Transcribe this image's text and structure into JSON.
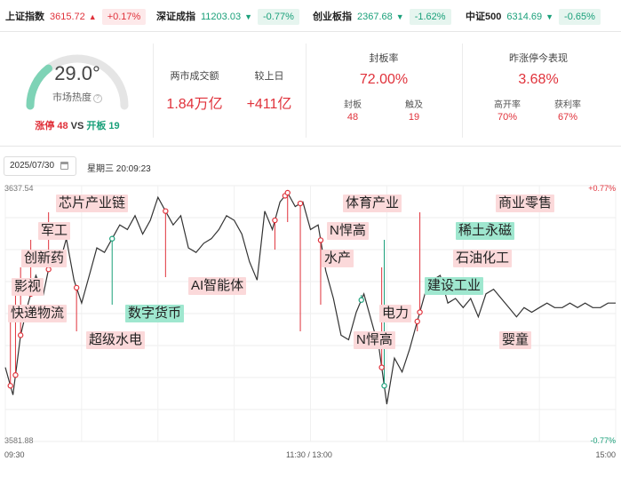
{
  "indices": [
    {
      "name": "上证指数",
      "value": "3615.72",
      "arrow": "▲",
      "change": "+0.17%",
      "dir": "up"
    },
    {
      "name": "深证成指",
      "value": "11203.03",
      "arrow": "▼",
      "change": "-0.77%",
      "dir": "down"
    },
    {
      "name": "创业板指",
      "value": "2367.68",
      "arrow": "▼",
      "change": "-1.62%",
      "dir": "down"
    },
    {
      "name": "中证500",
      "value": "6314.69",
      "arrow": "▼",
      "change": "-0.65%",
      "dir": "down"
    }
  ],
  "heat": {
    "value": "29.0°",
    "label": "市场热度",
    "help_icon": "question-icon",
    "limit_up_label": "涨停 48",
    "vs": "VS",
    "open_board_label": "开板 19",
    "level": 0.29
  },
  "turnover": {
    "label": "两市成交额",
    "value": "1.84万亿"
  },
  "vs_yesterday": {
    "label": "较上日",
    "value": "+411亿"
  },
  "seal_rate": {
    "label": "封板率",
    "value": "72.00%",
    "sub": [
      {
        "label": "封板",
        "value": "48"
      },
      {
        "label": "触及",
        "value": "19"
      }
    ]
  },
  "yesterday_perf": {
    "label": "昨涨停今表现",
    "value": "3.68%",
    "sub": [
      {
        "label": "高开率",
        "value": "70%"
      },
      {
        "label": "获利率",
        "value": "67%"
      }
    ]
  },
  "date": "2025/07/30",
  "weekday_time": "星期三 20:09:23",
  "colors": {
    "up": "#e0323b",
    "down": "#1aa07a",
    "line": "#333333",
    "tag_red": "#fbd9da",
    "tag_green": "#9fe7cf",
    "gauge": "#7ed3b6"
  },
  "chart_data": {
    "type": "line",
    "y_axis_labels": {
      "top": "3637.54",
      "bottom": "3581.88"
    },
    "right_axis_labels": {
      "top": "+0.77%",
      "bottom": "-0.77%"
    },
    "x_labels": [
      "09:30",
      "11:30 / 13:00",
      "15:00"
    ],
    "ylim": [
      3581.88,
      3637.54
    ],
    "grid": true,
    "series": [
      {
        "x": [
          0,
          3,
          6,
          9,
          12,
          15,
          18,
          21,
          24,
          27,
          30,
          33,
          36,
          39,
          42,
          45,
          48,
          51,
          54,
          57,
          60,
          63,
          66,
          69,
          72,
          75,
          78,
          81,
          84,
          87,
          90,
          93,
          96,
          99,
          102,
          105,
          108,
          111,
          114,
          117,
          120,
          123,
          126,
          129,
          132,
          135,
          138,
          141,
          144,
          147,
          150,
          153,
          156,
          159,
          162,
          165,
          168,
          171,
          174,
          177,
          180,
          183,
          186,
          189,
          192,
          195,
          198,
          201,
          204,
          207,
          210,
          213,
          216,
          219,
          222,
          225,
          228,
          231,
          234,
          237,
          240
        ],
        "values": [
          3598,
          3592,
          3605,
          3612,
          3618,
          3614,
          3622,
          3620,
          3626,
          3617,
          3612,
          3618,
          3624,
          3623,
          3626,
          3629,
          3628,
          3631,
          3627,
          3630,
          3635,
          3632,
          3629,
          3631,
          3624,
          3623,
          3625,
          3626,
          3628,
          3631,
          3630,
          3627,
          3621,
          3617,
          3632,
          3628,
          3634,
          3636,
          3633,
          3634,
          3628,
          3629,
          3619,
          3613,
          3605,
          3604,
          3610,
          3614,
          3608,
          3602,
          3590,
          3600,
          3597,
          3602,
          3608,
          3614,
          3617,
          3618,
          3612,
          3613,
          3611,
          3613,
          3609,
          3614,
          3615,
          3613,
          3611,
          3609,
          3611,
          3610,
          3611,
          3612,
          3611,
          3611,
          3612,
          3611,
          3612,
          3611,
          3611,
          3612,
          3612
        ]
      }
    ],
    "events": [
      {
        "label": "快递物流",
        "color": "red",
        "x": 2
      },
      {
        "label": "影视",
        "color": "red",
        "x": 4
      },
      {
        "label": "创新药",
        "color": "red",
        "x": 6
      },
      {
        "label": "军工",
        "color": "red",
        "x": 10
      },
      {
        "label": "芯片产业链",
        "color": "red",
        "x": 17
      },
      {
        "label": "超级水电",
        "color": "red",
        "x": 28
      },
      {
        "label": "数字货币",
        "color": "green",
        "x": 42
      },
      {
        "label": "AI智能体",
        "color": "red",
        "x": 63
      },
      {
        "label": "体育产业",
        "color": "red",
        "x": 110
      },
      {
        "label": "N悍高",
        "color": "red",
        "x": 111
      },
      {
        "label": "水产",
        "color": "red",
        "x": 106
      },
      {
        "label": "N悍高",
        "color": "red",
        "x": 116
      },
      {
        "label": "电力",
        "color": "red",
        "x": 124
      },
      {
        "label": "建设工业",
        "color": "green",
        "x": 140
      },
      {
        "label": "稀土永磁",
        "color": "green",
        "x": 149
      },
      {
        "label": "石油化工",
        "color": "red",
        "x": 148
      },
      {
        "label": "商业零售",
        "color": "red",
        "x": 163
      },
      {
        "label": "婴童",
        "color": "red",
        "x": 162
      }
    ]
  }
}
